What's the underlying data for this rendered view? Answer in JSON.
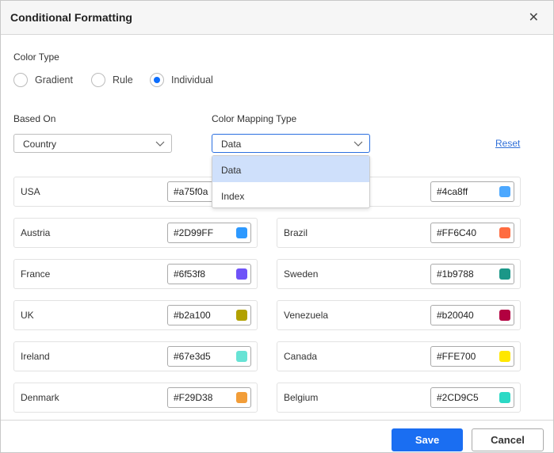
{
  "dialog": {
    "title": "Conditional Formatting"
  },
  "color_type": {
    "label": "Color Type",
    "options": [
      "Gradient",
      "Rule",
      "Individual"
    ],
    "selected": "Individual"
  },
  "based_on": {
    "label": "Based On",
    "value": "Country"
  },
  "mapping": {
    "label": "Color Mapping Type",
    "value": "Data",
    "options": [
      "Data",
      "Index"
    ],
    "highlighted": "Data"
  },
  "reset_label": "Reset",
  "items": [
    {
      "name": "USA",
      "hex": "#a75f0a",
      "swatch": "#a75f0a"
    },
    {
      "name": "",
      "hex": "#4ca8ff",
      "swatch": "#4ca8ff"
    },
    {
      "name": "Austria",
      "hex": "#2D99FF",
      "swatch": "#2D99FF"
    },
    {
      "name": "Brazil",
      "hex": "#FF6C40",
      "swatch": "#FF6C40"
    },
    {
      "name": "France",
      "hex": "#6f53f8",
      "swatch": "#6f53f8"
    },
    {
      "name": "Sweden",
      "hex": "#1b9788",
      "swatch": "#1b9788"
    },
    {
      "name": "UK",
      "hex": "#b2a100",
      "swatch": "#b2a100"
    },
    {
      "name": "Venezuela",
      "hex": "#b20040",
      "swatch": "#b20040"
    },
    {
      "name": "Ireland",
      "hex": "#67e3d5",
      "swatch": "#67e3d5"
    },
    {
      "name": "Canada",
      "hex": "#FFE700",
      "swatch": "#FFE700"
    },
    {
      "name": "Denmark",
      "hex": "#F29D38",
      "swatch": "#F29D38"
    },
    {
      "name": "Belgium",
      "hex": "#2CD9C5",
      "swatch": "#2CD9C5"
    }
  ],
  "footer": {
    "save": "Save",
    "cancel": "Cancel"
  }
}
